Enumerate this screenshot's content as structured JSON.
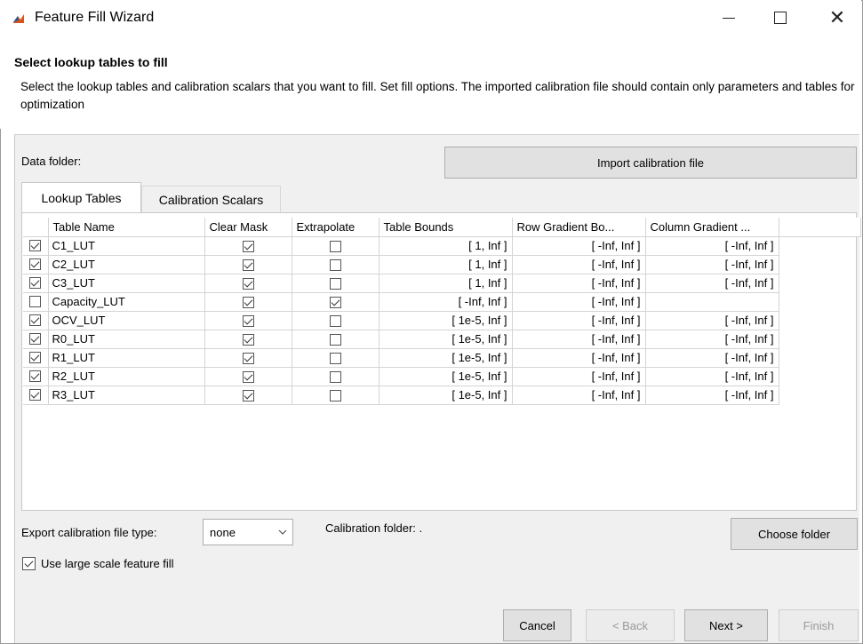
{
  "window": {
    "title": "Feature Fill Wizard",
    "minimize_glyph": "",
    "maximize_glyph": "",
    "close_glyph": "✕"
  },
  "header": {
    "title": "Select lookup tables to fill",
    "description": "Select the lookup tables and calibration scalars that you want to fill. Set fill options. The imported calibration file should contain only parameters and tables for optimization"
  },
  "data_folder": {
    "label": "Data folder:"
  },
  "import_button": {
    "label": "Import calibration file"
  },
  "tabs": [
    {
      "label": "Lookup Tables",
      "active": true
    },
    {
      "label": "Calibration Scalars",
      "active": false
    }
  ],
  "table": {
    "columns": [
      "",
      "Table Name",
      "Clear Mask",
      "Extrapolate",
      "Table Bounds",
      "Row Gradient Bo...",
      "Column Gradient ...",
      ""
    ],
    "rows": [
      {
        "selected": true,
        "name": "C1_LUT",
        "clear_mask": true,
        "extrapolate": false,
        "bounds": "[ 1, Inf ]",
        "row_gradient": "[ -Inf, Inf ]",
        "col_gradient": "[ -Inf, Inf ]"
      },
      {
        "selected": true,
        "name": "C2_LUT",
        "clear_mask": true,
        "extrapolate": false,
        "bounds": "[ 1, Inf ]",
        "row_gradient": "[ -Inf, Inf ]",
        "col_gradient": "[ -Inf, Inf ]"
      },
      {
        "selected": true,
        "name": "C3_LUT",
        "clear_mask": true,
        "extrapolate": false,
        "bounds": "[ 1, Inf ]",
        "row_gradient": "[ -Inf, Inf ]",
        "col_gradient": "[ -Inf, Inf ]"
      },
      {
        "selected": false,
        "name": "Capacity_LUT",
        "clear_mask": true,
        "extrapolate": true,
        "bounds": "[ -Inf, Inf ]",
        "row_gradient": "[ -Inf, Inf ]",
        "col_gradient": ""
      },
      {
        "selected": true,
        "name": "OCV_LUT",
        "clear_mask": true,
        "extrapolate": false,
        "bounds": "[ 1e-5, Inf ]",
        "row_gradient": "[ -Inf, Inf ]",
        "col_gradient": "[ -Inf, Inf ]"
      },
      {
        "selected": true,
        "name": "R0_LUT",
        "clear_mask": true,
        "extrapolate": false,
        "bounds": "[ 1e-5, Inf ]",
        "row_gradient": "[ -Inf, Inf ]",
        "col_gradient": "[ -Inf, Inf ]"
      },
      {
        "selected": true,
        "name": "R1_LUT",
        "clear_mask": true,
        "extrapolate": false,
        "bounds": "[ 1e-5, Inf ]",
        "row_gradient": "[ -Inf, Inf ]",
        "col_gradient": "[ -Inf, Inf ]"
      },
      {
        "selected": true,
        "name": "R2_LUT",
        "clear_mask": true,
        "extrapolate": false,
        "bounds": "[ 1e-5, Inf ]",
        "row_gradient": "[ -Inf, Inf ]",
        "col_gradient": "[ -Inf, Inf ]"
      },
      {
        "selected": true,
        "name": "R3_LUT",
        "clear_mask": true,
        "extrapolate": false,
        "bounds": "[ 1e-5, Inf ]",
        "row_gradient": "[ -Inf, Inf ]",
        "col_gradient": "[ -Inf, Inf ]"
      }
    ]
  },
  "export": {
    "label": "Export calibration file type:",
    "value": "none",
    "arrow_icon": "chevron-down-icon"
  },
  "calibration_folder": {
    "label": "Calibration folder:",
    "value": "."
  },
  "choose_folder_button": {
    "label": "Choose folder"
  },
  "large_scale": {
    "label": "Use large scale feature fill",
    "checked": true
  },
  "footer": {
    "cancel": "Cancel",
    "back": "< Back",
    "next": "Next >",
    "finish": "Finish"
  },
  "colors": {
    "panel_bg": "#f0f0f0",
    "button_bg": "#e1e1e1",
    "disabled_text": "#9a9a9a",
    "matlab_icon": "#d9531e"
  }
}
